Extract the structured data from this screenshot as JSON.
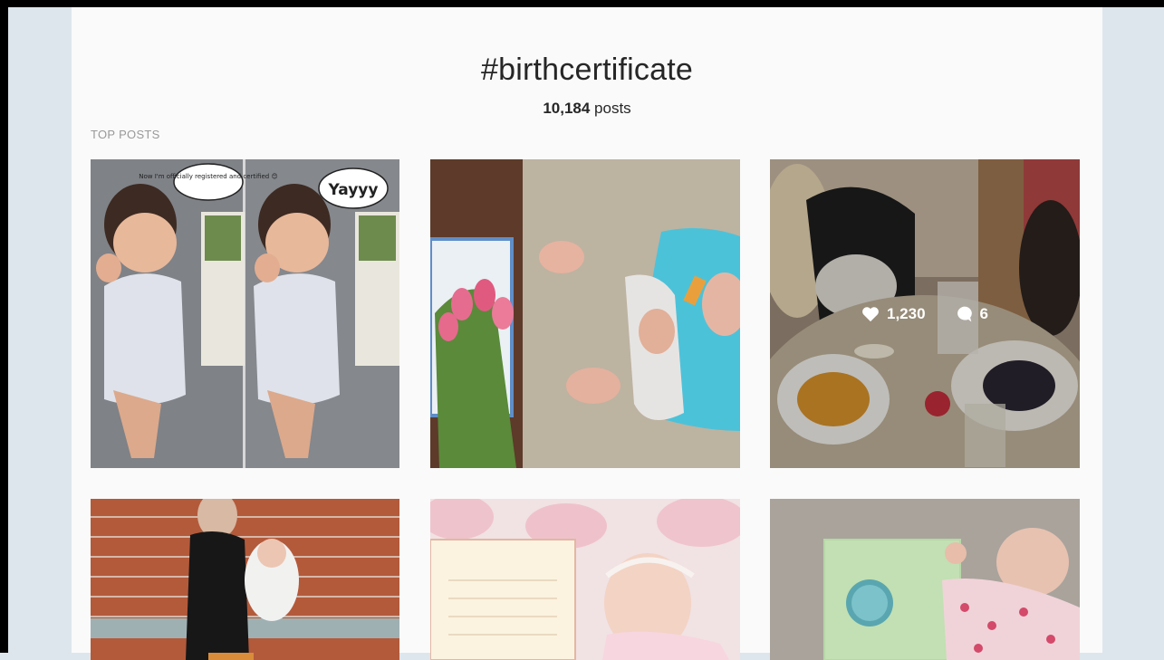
{
  "hashtag": {
    "title": "#birthcertificate"
  },
  "counts": {
    "posts_number": "10,184",
    "posts_word": "posts"
  },
  "section": {
    "label": "TOP POSTS"
  },
  "posts": [
    {
      "bubble_1": "Now I'm officially registered and certified 😊",
      "bubble_2": "Yayyy"
    },
    {},
    {
      "likes": "1,230",
      "comments": "6"
    },
    {},
    {},
    {}
  ],
  "colors": {
    "page_bg": "#fafafa",
    "side_bg": "#dde6ec",
    "text": "#262626",
    "muted": "#999999"
  },
  "icons": {
    "likes": "heart-icon",
    "comments": "comment-bubble-icon"
  }
}
